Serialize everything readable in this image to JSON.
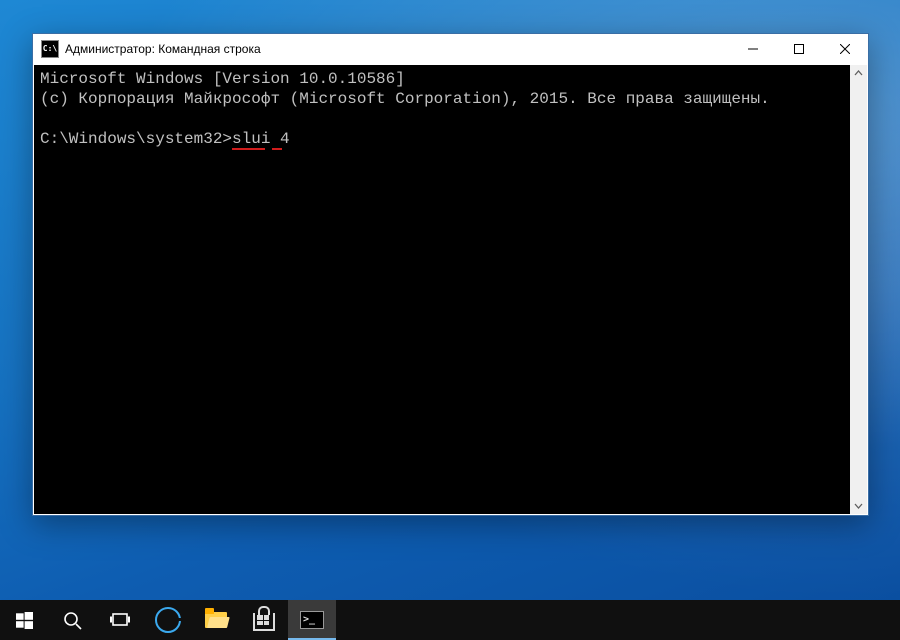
{
  "window": {
    "title": "Администратор: Командная строка",
    "icon_text": "C:\\"
  },
  "terminal": {
    "line1": "Microsoft Windows [Version 10.0.10586]",
    "line2": "(c) Корпорация Майкрософт (Microsoft Corporation), 2015. Все права защищены.",
    "prompt": "C:\\Windows\\system32>",
    "command": "slui 4"
  },
  "taskbar": {
    "items": [
      {
        "name": "start",
        "label": "Start"
      },
      {
        "name": "search",
        "label": "Search"
      },
      {
        "name": "taskview",
        "label": "Task View"
      },
      {
        "name": "edge",
        "label": "Microsoft Edge"
      },
      {
        "name": "explorer",
        "label": "File Explorer"
      },
      {
        "name": "store",
        "label": "Store"
      },
      {
        "name": "cmd",
        "label": "Command Prompt",
        "active": true
      }
    ]
  }
}
